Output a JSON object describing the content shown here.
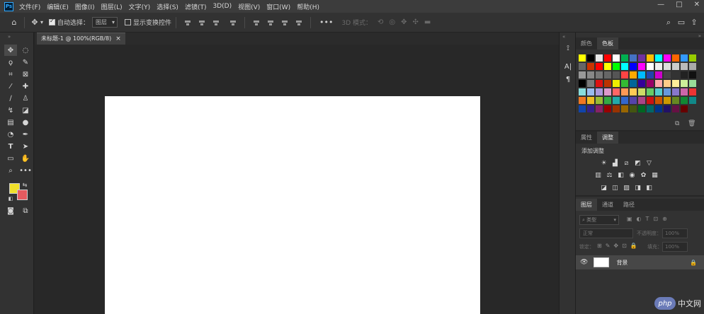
{
  "app": {
    "logo": "Ps"
  },
  "menu": [
    "文件(F)",
    "编辑(E)",
    "图像(I)",
    "图层(L)",
    "文字(Y)",
    "选择(S)",
    "滤镜(T)",
    "3D(D)",
    "视图(V)",
    "窗口(W)",
    "帮助(H)"
  ],
  "window_controls": [
    "—",
    "□",
    "✕"
  ],
  "options": {
    "auto_select_label": "自动选择：",
    "auto_select_value": "图层",
    "transform_label": "显示变换控件",
    "mode_label": "3D 模式："
  },
  "document": {
    "tab_title": "未标题-1 @ 100%(RGB/8)",
    "close": "×"
  },
  "swatches_panel": {
    "tabs": [
      "颜色",
      "色板"
    ],
    "colors": [
      "#ffff00",
      "#000000",
      "#e8e8e8",
      "#ff0000",
      "#ffffff",
      "#00b050",
      "#4472c4",
      "#7030a0",
      "#ffc000",
      "#00ffff",
      "#ff00ff",
      "#ff6600",
      "#3399ff",
      "#99cc00",
      "#666666",
      "#cc3300",
      "#ff0000",
      "#ffff00",
      "#00ff00",
      "#00ffff",
      "#0000ff",
      "#ff00ff",
      "#ffffff",
      "#eeeeee",
      "#dddddd",
      "#cccccc",
      "#bbbbbb",
      "#aaaaaa",
      "#999999",
      "#888888",
      "#777777",
      "#666666",
      "#555555",
      "#ff4444",
      "#ffaa00",
      "#00bbff",
      "#2244aa",
      "#cc00cc",
      "#444444",
      "#333333",
      "#222222",
      "#111111",
      "#000000",
      "#7a7a7a",
      "#dd1111",
      "#bb3300",
      "#eeee00",
      "#33bb33",
      "#006699",
      "#330099",
      "#990066",
      "#ffaaaa",
      "#ffcc88",
      "#ffee99",
      "#ccee99",
      "#99dd99",
      "#88dddd",
      "#99bbee",
      "#aa99dd",
      "#dd99cc",
      "#ff6666",
      "#ff9955",
      "#ffcc55",
      "#ccdd66",
      "#66cc66",
      "#55cccc",
      "#6699dd",
      "#8877cc",
      "#cc66aa",
      "#ee3333",
      "#ee7722",
      "#eebb22",
      "#99bb33",
      "#33aa44",
      "#22aaaa",
      "#3366cc",
      "#5544aa",
      "#aa4488",
      "#cc1111",
      "#cc5500",
      "#cc9900",
      "#668822",
      "#118833",
      "#118888",
      "#1144aa",
      "#332288",
      "#882266",
      "#990000",
      "#993300",
      "#996600",
      "#445511",
      "#006622",
      "#006666",
      "#003388",
      "#221166",
      "#661144",
      "#660000"
    ]
  },
  "adjustments_panel": {
    "tabs": [
      "属性",
      "调整"
    ],
    "heading": "添加调整",
    "row1": [
      "sun-icon",
      "levels-icon",
      "curves-icon",
      "exposure-icon",
      "triangle-icon"
    ],
    "row2": [
      "vibrance-icon",
      "balance-icon",
      "bw-icon",
      "camera-icon",
      "mixer-icon",
      "lookup-icon"
    ],
    "row3": [
      "invert-icon",
      "posterize-icon",
      "threshold-icon",
      "map-icon",
      "selective-icon"
    ]
  },
  "layers_panel": {
    "tabs": [
      "图层",
      "通道",
      "路径"
    ],
    "filter_placeholder": "类型",
    "blend_mode": "正常",
    "opacity_label": "不透明度：",
    "opacity_value": "100%",
    "lock_label": "锁定：",
    "fill_label": "填充：",
    "fill_value": "100%",
    "layers": [
      {
        "name": "背景"
      }
    ]
  },
  "watermark": {
    "logo": "php",
    "text": "中文网"
  }
}
